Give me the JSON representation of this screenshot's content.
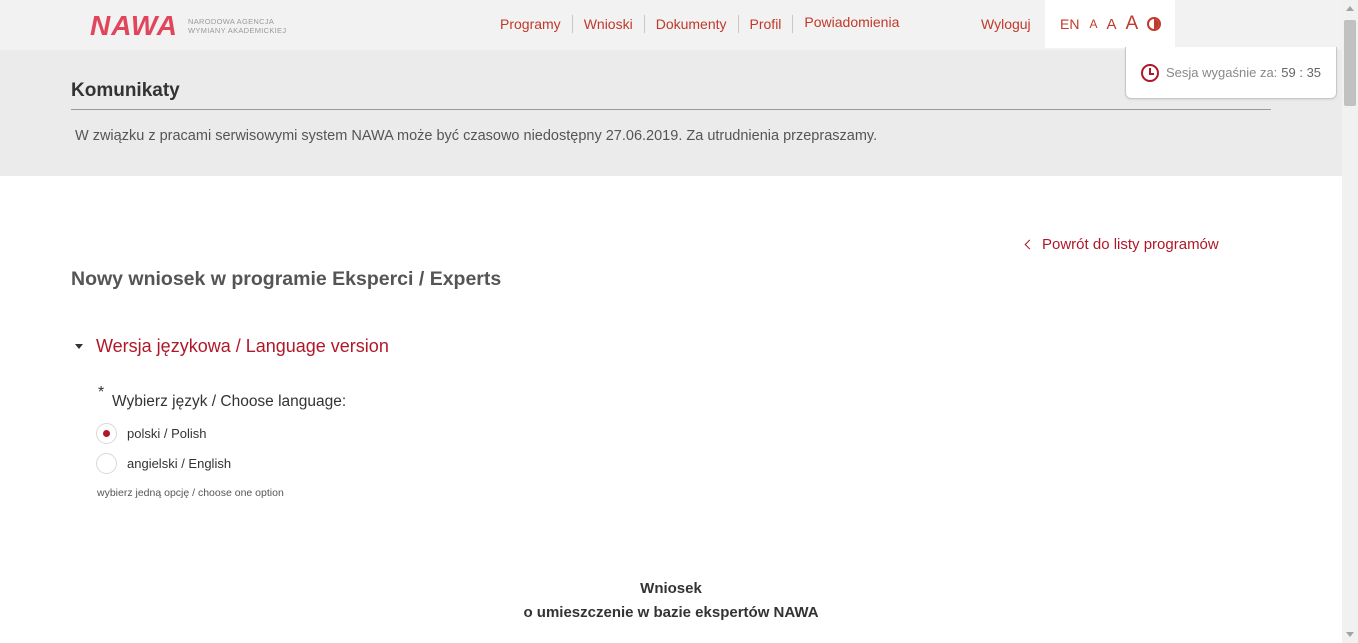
{
  "header": {
    "logo": {
      "word": "NAWA",
      "sub_line1": "Narodowa Agencja",
      "sub_line2": "Wymiany Akademickiej"
    },
    "nav": [
      "Programy",
      "Wnioski",
      "Dokumenty",
      "Profil",
      "Powiadomienia"
    ],
    "logout": "Wyloguj",
    "a11y": {
      "lang": "EN",
      "font_small": "A",
      "font_medium": "A",
      "font_large": "A",
      "contrast_icon": "contrast-icon"
    }
  },
  "session": {
    "label": "Sesja wygaśnie za:",
    "time": "59 : 35",
    "icon": "clock-icon"
  },
  "komunikaty": {
    "title": "Komunikaty",
    "message": "W związku z pracami serwisowymi system NAWA może być czasowo niedostępny 27.06.2019. Za utrudnienia przepraszamy."
  },
  "main": {
    "back_link": "Powrót do listy programów",
    "page_title": "Nowy wniosek w programie Eksperci / Experts",
    "section_title": "Wersja językowa / Language version",
    "required_mark": "*",
    "field_label": "Wybierz język / Choose language:",
    "options": [
      {
        "label": "polski / Polish",
        "checked": true
      },
      {
        "label": "angielski / English",
        "checked": false
      }
    ],
    "hint": "wybierz jedną opcję / choose one option",
    "doc_title_line1": "Wniosek",
    "doc_title_line2": "o umieszczenie w bazie ekspertów NAWA"
  },
  "colors": {
    "accent": "#b0182a",
    "logo": "#e0455c",
    "header_bg": "#f2f2f2",
    "band_bg": "#ebebeb"
  }
}
